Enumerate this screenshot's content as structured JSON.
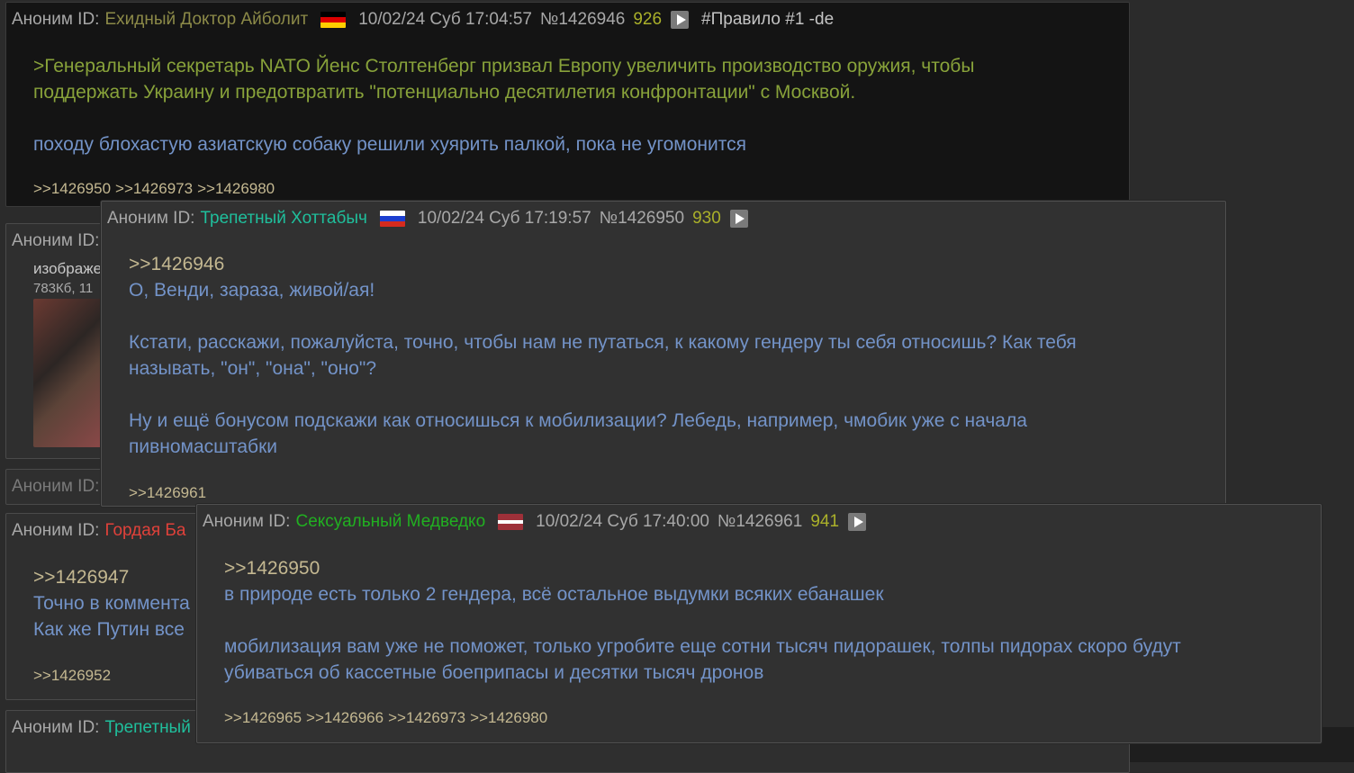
{
  "anon_label": "Аноним ID:",
  "posts": {
    "op": {
      "id_name": "Ехидный Доктор Айболит",
      "id_color": "#8c8a48",
      "flag": "germany-flag-icon",
      "date": "10/02/24 Суб 17:04:57",
      "num": "№1426946",
      "count": "926",
      "tag": "#Правило #1 -de",
      "quote_lines": [
        "Генеральный секретарь NATO Йенс Столтенберг призвал Европу увеличить производство оружия, чтобы",
        "поддержать Украину и предотвратить \"потенциально десятилетия конфронтации\" с Москвой."
      ],
      "quote_prefix": ">",
      "text": "походу блохастую азиатскую собаку решили хуярить палкой, пока не угомонится",
      "replies": [
        ">>1426950",
        ">>1426973",
        ">>1426980"
      ]
    },
    "bg2": {
      "text_line1": "изображе",
      "text_line2": "783Кб, 11"
    },
    "bg4": {
      "id_name": "Гордая Ба",
      "id_color": "#e0413a",
      "reply": ">>1426947",
      "line1": "Точно в коммента",
      "line2": "Как же Путин все",
      "replies": [
        ">>1426952"
      ]
    },
    "bg5": {
      "id_name": "Трепетный",
      "id_color": "#1fbf9c"
    },
    "p2": {
      "id_name": "Трепетный Хоттабыч",
      "id_color": "#1fbf9c",
      "flag": "russia-flag-icon",
      "date": "10/02/24 Суб 17:19:57",
      "num": "№1426950",
      "count": "930",
      "reply": ">>1426946",
      "line1": "О, Венди, зараза, живой/ая!",
      "line2a": "Кстати, расскажи, пожалуйста, точно, чтобы нам не путаться, к какому гендеру ты себя относишь? Как тебя",
      "line2b": "называть, \"он\", \"она\", \"оно\"?",
      "line3a": "Ну и ещё бонусом подскажи как относишься к мобилизации? Лебедь, например, чмобик уже с начала",
      "line3b": "пивномасштабки",
      "replies": [
        ">>1426961"
      ]
    },
    "p3": {
      "id_name": "Сексуальный Медведко",
      "id_color": "#21b021",
      "flag": "latvia-flag-icon",
      "date": "10/02/24 Суб 17:40:00",
      "num": "№1426961",
      "count": "941",
      "reply": ">>1426950",
      "line1": "в природе есть только 2 гендера, всё остальное выдумки всяких ебанашек",
      "line2a": "мобилизация вам уже не поможет, только угробите еще сотни тысяч пидорашек, толпы пидорах скоро будут",
      "line2b": "убиваться об кассетные боеприпасы и десятки тысяч дронов",
      "replies": [
        ">>1426965",
        ">>1426966",
        ">>1426973",
        ">>1426980"
      ]
    }
  }
}
